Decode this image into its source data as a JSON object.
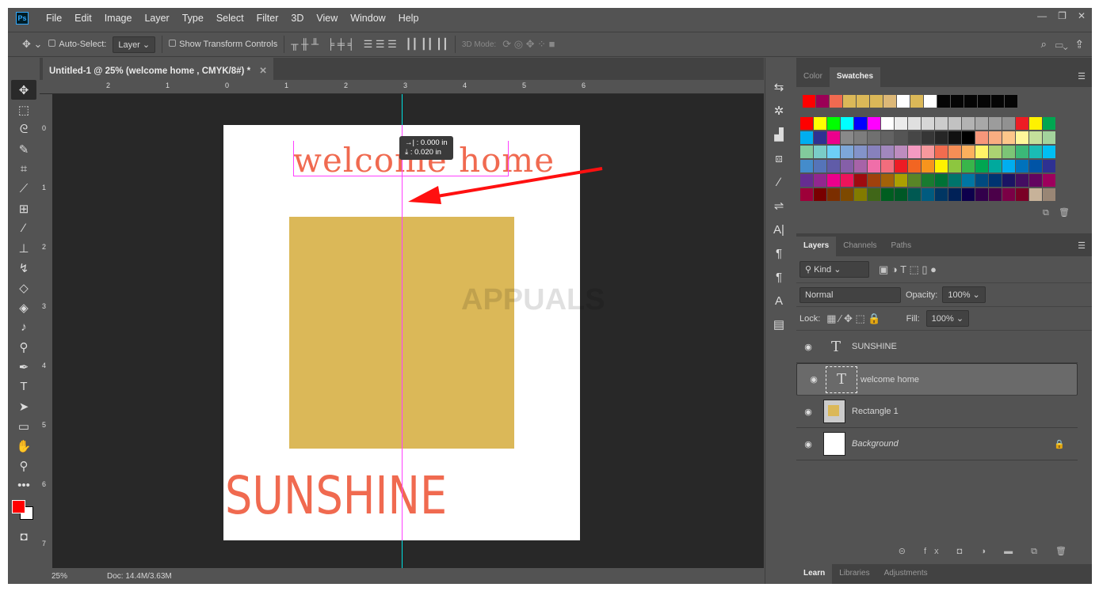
{
  "app": {
    "logo": "Ps",
    "menu": [
      "File",
      "Edit",
      "Image",
      "Layer",
      "Type",
      "Select",
      "Filter",
      "3D",
      "View",
      "Window",
      "Help"
    ]
  },
  "options": {
    "auto_select": "Auto-Select:",
    "layer_select": "Layer",
    "show_transform": "Show Transform Controls",
    "mode_3d": "3D Mode:"
  },
  "document": {
    "tab_title": "Untitled-1 @ 25% (welcome home , CMYK/8#) *",
    "welcome_text": "welcome home",
    "sunshine_text": "SUNSHINE",
    "rect_color": "#dbb858",
    "text_color": "#f06a50"
  },
  "ruler": {
    "h": [
      "2",
      "1",
      "0",
      "1",
      "2",
      "3",
      "4",
      "5",
      "6"
    ],
    "v": [
      "0",
      "1",
      "2",
      "3",
      "4",
      "5",
      "6",
      "7"
    ]
  },
  "tooltip": {
    "x": "0.000 in",
    "y": "0.020 in"
  },
  "status": {
    "zoom": "25%",
    "doc": "Doc: 14.4M/3.63M"
  },
  "swatches_panel": {
    "tabs": [
      "Color",
      "Swatches"
    ],
    "recent": [
      "#ff0000",
      "#9b0056",
      "#f06a50",
      "#dbb858",
      "#dbb858",
      "#dbb858",
      "#ddb877",
      "#ffffff",
      "#dbb858",
      "#ffffff",
      "#050505",
      "#050505",
      "#050505",
      "#050505",
      "#050505",
      "#050505"
    ],
    "grid": [
      [
        "#ff0000",
        "#ffff00",
        "#00ff00",
        "#00ffff",
        "#0000ff",
        "#ff00ff",
        "#ffffff",
        "#ebebeb",
        "#e0e0e0",
        "#d6d6d6",
        "#cccccc",
        "#c2c2c2",
        "#b3b3b3",
        "#a8a8a8",
        "#9c9c9c",
        "#919191",
        "#ed1c24",
        "#fff200",
        "#00a651"
      ],
      [
        "#00aeef",
        "#2e3192",
        "#ec008c",
        "#898989",
        "#7d7d7d",
        "#707070",
        "#636363",
        "#555555",
        "#464646",
        "#363636",
        "#262626",
        "#111111",
        "#000000",
        "#f7977a",
        "#f9ad81",
        "#fdc68a",
        "#fff79a",
        "#c4df9b",
        "#a3d39c"
      ],
      [
        "#82ca9c",
        "#7accc8",
        "#6dcff6",
        "#7da7d9",
        "#8393ca",
        "#8781bd",
        "#a187be",
        "#bd8cbf",
        "#f49ac1",
        "#f6989d",
        "#f26c4f",
        "#f68e56",
        "#fbaf5d",
        "#fff467",
        "#acd372",
        "#7cc576",
        "#3bb878",
        "#1abbb4",
        "#00bff3"
      ],
      [
        "#448ccb",
        "#5574b9",
        "#605ca8",
        "#855fa8",
        "#a763a8",
        "#f06ea9",
        "#f26d7d",
        "#ed1c24",
        "#f26522",
        "#f7941d",
        "#fff200",
        "#8dc63f",
        "#39b54a",
        "#00a651",
        "#00a99d",
        "#00aeef",
        "#0072bc",
        "#0054a6",
        "#2e3192"
      ],
      [
        "#662d91",
        "#92278f",
        "#ec008c",
        "#ed145b",
        "#9e0b0f",
        "#a0410d",
        "#a36209",
        "#aba000",
        "#598527",
        "#197b30",
        "#007236",
        "#00746b",
        "#0076a3",
        "#004a80",
        "#003471",
        "#1b1464",
        "#440e62",
        "#630460",
        "#9e005d"
      ],
      [
        "#9e0039",
        "#790000",
        "#7b2e00",
        "#7d4900",
        "#827b00",
        "#406618",
        "#005e20",
        "#005826",
        "#005952",
        "#005b7f",
        "#003663",
        "#002157",
        "#0d004c",
        "#32004b",
        "#4b0049",
        "#7b0046",
        "#7a0026",
        "#c7b299",
        "#998675"
      ]
    ]
  },
  "layers_panel": {
    "tabs": [
      "Layers",
      "Channels",
      "Paths"
    ],
    "kind": "Kind",
    "blend": "Normal",
    "opacity_label": "Opacity:",
    "opacity": "100%",
    "lock_label": "Lock:",
    "fill_label": "Fill:",
    "fill": "100%",
    "layers": [
      {
        "name": "SUNSHINE"
      },
      {
        "name": "welcome home"
      },
      {
        "name": "Rectangle 1"
      },
      {
        "name": "Background"
      }
    ]
  },
  "bottom_tabs": [
    "Learn",
    "Libraries",
    "Adjustments"
  ],
  "watermark": "APPUALS"
}
